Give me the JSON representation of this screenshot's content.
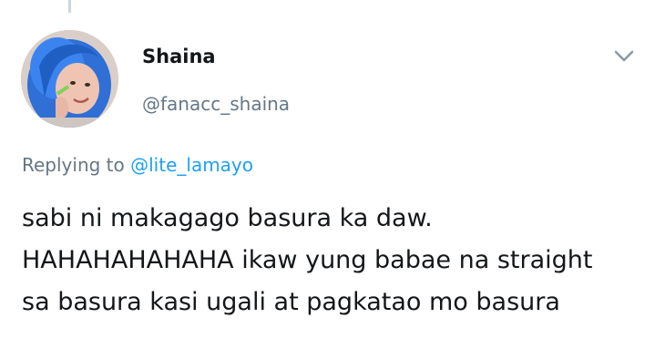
{
  "tweet": {
    "author": {
      "display_name": "Shaina",
      "handle": "@fanacc_shaina",
      "avatar_icon": "user-avatar-photo"
    },
    "menu_icon": "chevron-down-icon",
    "reply_context": {
      "prefix": "Replying to",
      "mention": "@lite_lamayo"
    },
    "text_lines": [
      "sabi ni makagago basura ka daw.",
      "HAHAHAHAHAHA ikaw yung babae na straight",
      "sa basura kasi ugali at pagkatao mo basura"
    ]
  },
  "colors": {
    "primary_text": "#14171a",
    "secondary_text": "#657786",
    "link": "#1da1f2",
    "thread_line": "#ccd6dd"
  }
}
